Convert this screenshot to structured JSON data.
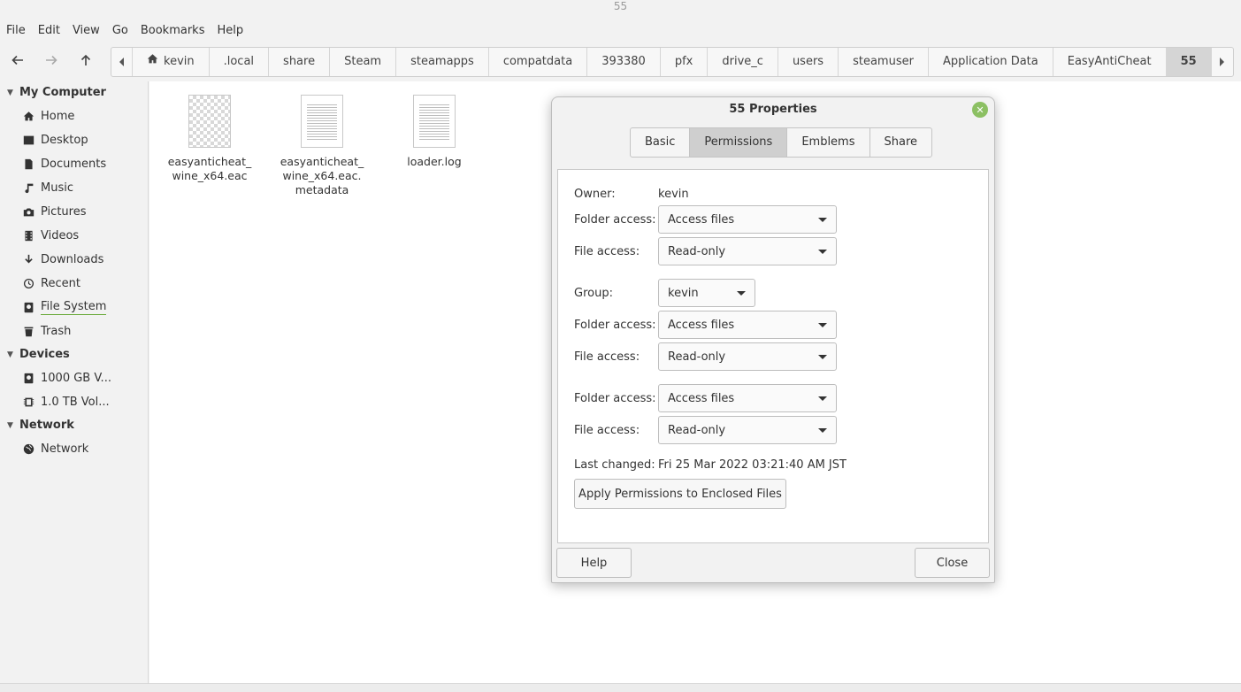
{
  "window": {
    "title": "55"
  },
  "menubar": [
    "File",
    "Edit",
    "View",
    "Go",
    "Bookmarks",
    "Help"
  ],
  "toolbar": {
    "back_icon": "arrow-left-icon",
    "forward_icon": "arrow-right-icon",
    "up_icon": "arrow-up-icon"
  },
  "pathbar": {
    "crumbs": [
      "kevin",
      ".local",
      "share",
      "Steam",
      "steamapps",
      "compatdata",
      "393380",
      "pfx",
      "drive_c",
      "users",
      "steamuser",
      "Application Data",
      "EasyAntiCheat",
      "55"
    ],
    "home_icon": "home-icon"
  },
  "sidebar": {
    "sections": [
      {
        "title": "My Computer",
        "items": [
          {
            "label": "Home",
            "icon": "home-icon"
          },
          {
            "label": "Desktop",
            "icon": "desktop-icon"
          },
          {
            "label": "Documents",
            "icon": "document-icon"
          },
          {
            "label": "Music",
            "icon": "music-icon"
          },
          {
            "label": "Pictures",
            "icon": "camera-icon"
          },
          {
            "label": "Videos",
            "icon": "film-icon"
          },
          {
            "label": "Downloads",
            "icon": "download-icon"
          },
          {
            "label": "Recent",
            "icon": "history-icon"
          },
          {
            "label": "File System",
            "icon": "drive-icon"
          },
          {
            "label": "Trash",
            "icon": "trash-icon"
          }
        ]
      },
      {
        "title": "Devices",
        "items": [
          {
            "label": "1000 GB V...",
            "icon": "drive-icon"
          },
          {
            "label": "1.0 TB Vol...",
            "icon": "chip-icon"
          }
        ]
      },
      {
        "title": "Network",
        "items": [
          {
            "label": "Network",
            "icon": "globe-icon"
          }
        ]
      }
    ]
  },
  "files": [
    {
      "name_line1": "easyanticheat_",
      "name_line2": "wine_x64.eac",
      "name_line3": "",
      "thumb": "image"
    },
    {
      "name_line1": "easyanticheat_",
      "name_line2": "wine_x64.eac.",
      "name_line3": "metadata",
      "thumb": "text"
    },
    {
      "name_line1": "loader.log",
      "name_line2": "",
      "name_line3": "",
      "thumb": "text"
    }
  ],
  "dialog": {
    "title": "55 Properties",
    "tabs": [
      "Basic",
      "Permissions",
      "Emblems",
      "Share"
    ],
    "active_tab": "Permissions",
    "owner_label": "Owner:",
    "owner_value": "kevin",
    "group_label": "Group:",
    "group_value": "kevin",
    "folder_access_label": "Folder access:",
    "file_access_label": "File access:",
    "owner_folder_access": "Access files",
    "owner_file_access": "Read-only",
    "group_folder_access": "Access files",
    "group_file_access": "Read-only",
    "others_folder_access": "Access files",
    "others_file_access": "Read-only",
    "last_changed_label": "Last changed:",
    "last_changed_value": "Fri 25 Mar 2022 03:21:40 AM JST",
    "apply_button": "Apply Permissions to Enclosed Files",
    "help_button": "Help",
    "close_button": "Close"
  }
}
